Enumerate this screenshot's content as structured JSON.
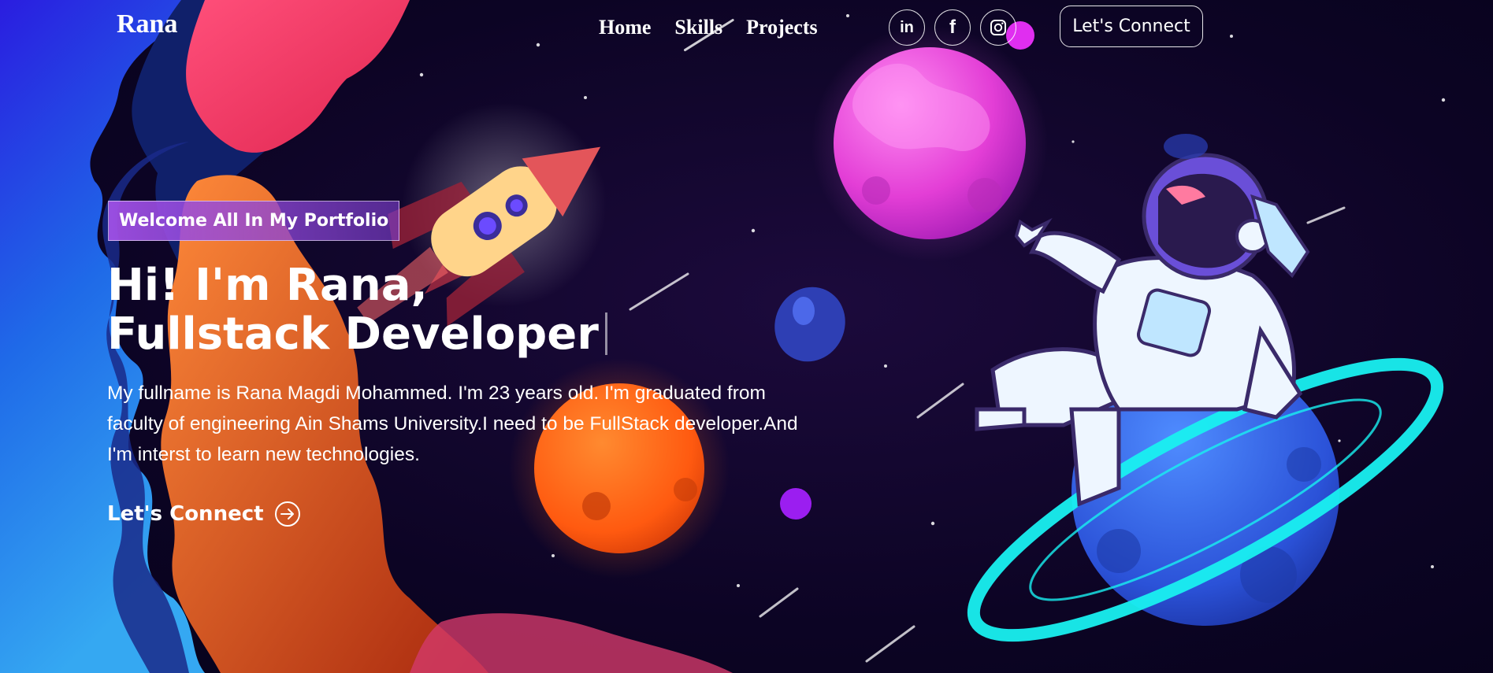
{
  "brand": {
    "name": "Rana"
  },
  "nav": {
    "items": [
      "Home",
      "Skills",
      "Projects"
    ]
  },
  "socials": [
    {
      "icon": "linkedin-icon",
      "label": "in"
    },
    {
      "icon": "facebook-icon",
      "label": "f"
    },
    {
      "icon": "instagram-icon",
      "label": ""
    }
  ],
  "header": {
    "connect_label": "Let's Connect"
  },
  "hero": {
    "tagline": "Welcome All In My Portfolio",
    "headline_line1": "Hi! I'm Rana,",
    "headline_line2": "Fullstack Developer",
    "bio": "My fullname is Rana Magdi Mohammed. I'm 23 years old. I'm graduated from faculty of engineering Ain Shams University.I need to be FullStack developer.And I'm interst to learn new technologies.",
    "cta_label": "Let's Connect"
  },
  "colors": {
    "background": "#0a0420",
    "accent_purple": "#9b4de0",
    "ring_cyan": "#19f0f0",
    "planet_pink": "#e94fd8",
    "planet_orange": "#ff6a1a",
    "planet_blue": "#2f64e8"
  }
}
